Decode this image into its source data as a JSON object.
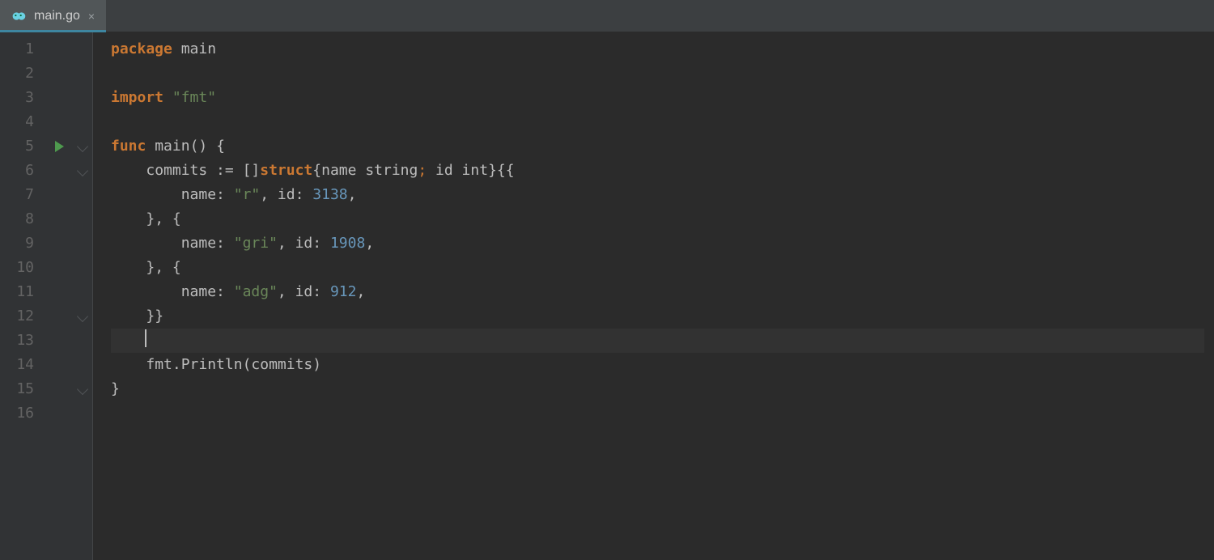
{
  "tab": {
    "filename": "main.go",
    "close_glyph": "×"
  },
  "line_numbers": [
    "1",
    "2",
    "3",
    "4",
    "5",
    "6",
    "7",
    "8",
    "9",
    "10",
    "11",
    "12",
    "13",
    "14",
    "15",
    "16"
  ],
  "run_icon_line": 5,
  "fold_open_lines": [
    5,
    6
  ],
  "fold_close_lines": [
    12,
    15
  ],
  "cursor_line": 13,
  "code": {
    "l1_kw": "package",
    "l1_ident": "main",
    "l3_kw": "import",
    "l3_str": "\"fmt\"",
    "l5_kw": "func",
    "l5_name": "main",
    "l5_rest": "() {",
    "l6_a": "commits := []",
    "l6_kw": "struct",
    "l6_b": "{name ",
    "l6_t1": "string",
    "l6_semi": ";",
    "l6_c": " id ",
    "l6_t2": "int",
    "l6_d": "}{{",
    "l7_a": "name: ",
    "l7_s": "\"r\"",
    "l7_b": ", id: ",
    "l7_n": "3138",
    "l7_c": ",",
    "l8": "}, {",
    "l9_a": "name: ",
    "l9_s": "\"gri\"",
    "l9_b": ", id: ",
    "l9_n": "1908",
    "l9_c": ",",
    "l10": "}, {",
    "l11_a": "name: ",
    "l11_s": "\"adg\"",
    "l11_b": ", id: ",
    "l11_n": "912",
    "l11_c": ",",
    "l12": "}}",
    "l14": "fmt.Println(commits)",
    "l15": "}",
    "indent1": "    ",
    "indent2": "        "
  }
}
